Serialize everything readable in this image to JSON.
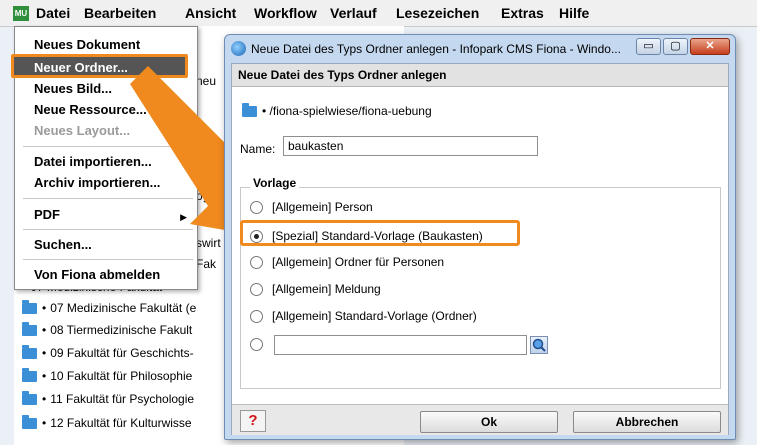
{
  "app": {
    "logo_text": "MU",
    "menu": [
      "Datei",
      "Bearbeiten",
      "Ansicht",
      "Workflow",
      "Verlauf",
      "Lesezeichen",
      "Extras",
      "Hilfe"
    ]
  },
  "file_menu": {
    "items": [
      {
        "label": "Neues Dokument",
        "disabled": false
      },
      {
        "label": "Neuer Ordner...",
        "disabled": false,
        "highlighted": true
      },
      {
        "label": "Neues Bild...",
        "disabled": false
      },
      {
        "label": "Neue Ressource...",
        "disabled": false
      },
      {
        "label": "Neues Layout...",
        "disabled": true
      },
      {
        "label": "Datei importieren...",
        "disabled": false
      },
      {
        "label": "Archiv importieren...",
        "disabled": false
      },
      {
        "label": "PDF",
        "disabled": false,
        "submenu": true
      },
      {
        "label": "Suchen...",
        "disabled": false
      },
      {
        "label": "Von Fiona abmelden",
        "disabled": false
      }
    ]
  },
  "tree": {
    "fragments": [
      "neu",
      "ogisc",
      "swirt",
      "Fak"
    ],
    "rows": [
      "07 Medizinische Fakultät (e",
      "08 Tiermedizinische Fakult",
      "09 Fakultät für Geschichts-",
      "10 Fakultät für Philosophie",
      "11 Fakultät für Psychologie",
      "12 Fakultät für Kulturwisse"
    ],
    "cut_row": "07 Medizinische Fakultät"
  },
  "dialog": {
    "window_title": "Neue Datei des Typs Ordner anlegen - Infopark CMS Fiona - Windo...",
    "window_buttons": {
      "minimize": "▭",
      "maximize": "▢",
      "close": "✕"
    },
    "header": "Neue Datei des Typs Ordner anlegen",
    "path": "/fiona-spielwiese/fiona-uebung",
    "name_label": "Name:",
    "name_value": "baukasten",
    "template_legend": "Vorlage",
    "templates": [
      {
        "label": "[Allgemein] Person",
        "checked": false
      },
      {
        "label": "[Spezial] Standard-Vorlage (Baukasten)",
        "checked": true
      },
      {
        "label": "[Allgemein] Ordner für Personen",
        "checked": false
      },
      {
        "label": "[Allgemein] Meldung",
        "checked": false
      },
      {
        "label": "[Allgemein] Standard-Vorlage (Ordner)",
        "checked": false
      }
    ],
    "custom_template_value": "",
    "help_symbol": "?",
    "ok_label": "Ok",
    "cancel_label": "Abbrechen"
  },
  "colors": {
    "highlight": "#f08a1e",
    "title_bar": "#c4d8ef"
  }
}
